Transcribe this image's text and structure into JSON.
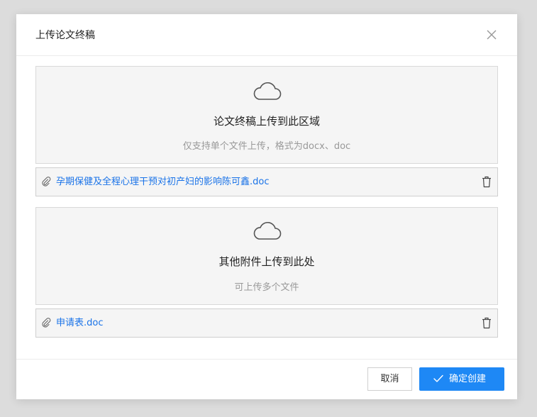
{
  "dialog": {
    "title": "上传论文终稿",
    "close_icon": "close-icon"
  },
  "thesis_upload": {
    "icon": "cloud-icon",
    "title": "论文终稿上传到此区域",
    "hint": "仅支持单个文件上传，格式为docx、doc",
    "file": {
      "icon": "paperclip-icon",
      "name": "孕期保健及全程心理干预对初产妇的影响陈可鑫.doc",
      "delete_icon": "trash-icon"
    }
  },
  "attachments_upload": {
    "icon": "cloud-icon",
    "title": "其他附件上传到此处",
    "hint": "可上传多个文件",
    "file": {
      "icon": "paperclip-icon",
      "name": "申请表.doc",
      "delete_icon": "trash-icon"
    }
  },
  "footer": {
    "cancel_label": "取消",
    "confirm_label": "确定创建",
    "confirm_icon": "check-icon"
  },
  "colors": {
    "primary": "#1e88f5",
    "link": "#1a73e8",
    "overlay": "#dcdcdc"
  }
}
